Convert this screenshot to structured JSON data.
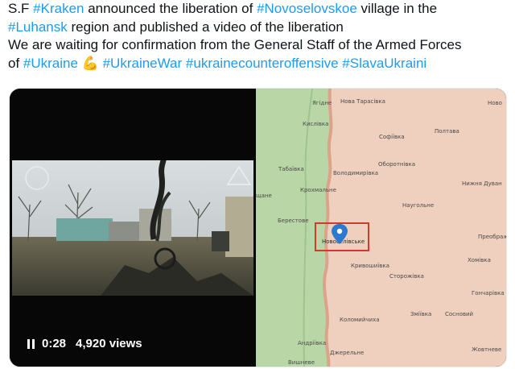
{
  "tweet": {
    "line1": {
      "t1": "S.F ",
      "tag1": "#Kraken",
      "t2": " announced the liberation of ",
      "tag2": "#Novoselovskoe",
      "t3": " village in the"
    },
    "line2": {
      "tag1": "#Luhansk",
      "t1": " region and published a video of the liberation"
    },
    "line3": {
      "t1": "We are waiting for confirmation from the General Staff of the Armed Forces"
    },
    "line4": {
      "t1": "of ",
      "tag1": "#Ukraine",
      "emoji": "💪",
      "tag2": "#UkraineWar",
      "tag3": "#ukrainecounteroffensive",
      "tag4": "#SlavaUkraini"
    }
  },
  "video": {
    "time": "0:28",
    "views": "4,920 views",
    "pause_icon": "pause-icon"
  },
  "map": {
    "labels": {
      "yagidne": "Ягідне",
      "nova_tarasivka": "Нова Тарасівка",
      "novo": "Ново",
      "kyslivka": "Кислівка",
      "sofiivka": "Софіївка",
      "poltava": "Полтава",
      "oborotnivka": "Оборотнівка",
      "tabaivka": "Табаївка",
      "volodymyrivka": "Володимирівка",
      "nyzhnia_duvan": "Нижня Дуван",
      "shchane": "щане",
      "krokhmalne": "Крохмальне",
      "nauhol": "Наугольне",
      "berestove": "Берестове",
      "novoselivske": "Новоселівське",
      "preobrazh": "Преображ",
      "khomivka": "Хомівка",
      "kryvoshyivka": "Кривошиївка",
      "storozhivka": "Сторожівка",
      "honcharivka": "Гончарівка",
      "kolomyichykha": "Коломийчиха",
      "zmiivka": "Зміївка",
      "sosnovyi": "Сосновий",
      "andriivka": "Андріївка",
      "dzherelne": "Джерельне",
      "vyshneve": "Вишневе",
      "zhovtneve": "Жовтневе"
    },
    "colors": {
      "ukraine_area": "#b9d7a6",
      "occupied_area": "#efcfbd",
      "frontline": "#d9a489",
      "marker": "#2e79d0",
      "highlight_box": "#d43a2a"
    }
  }
}
